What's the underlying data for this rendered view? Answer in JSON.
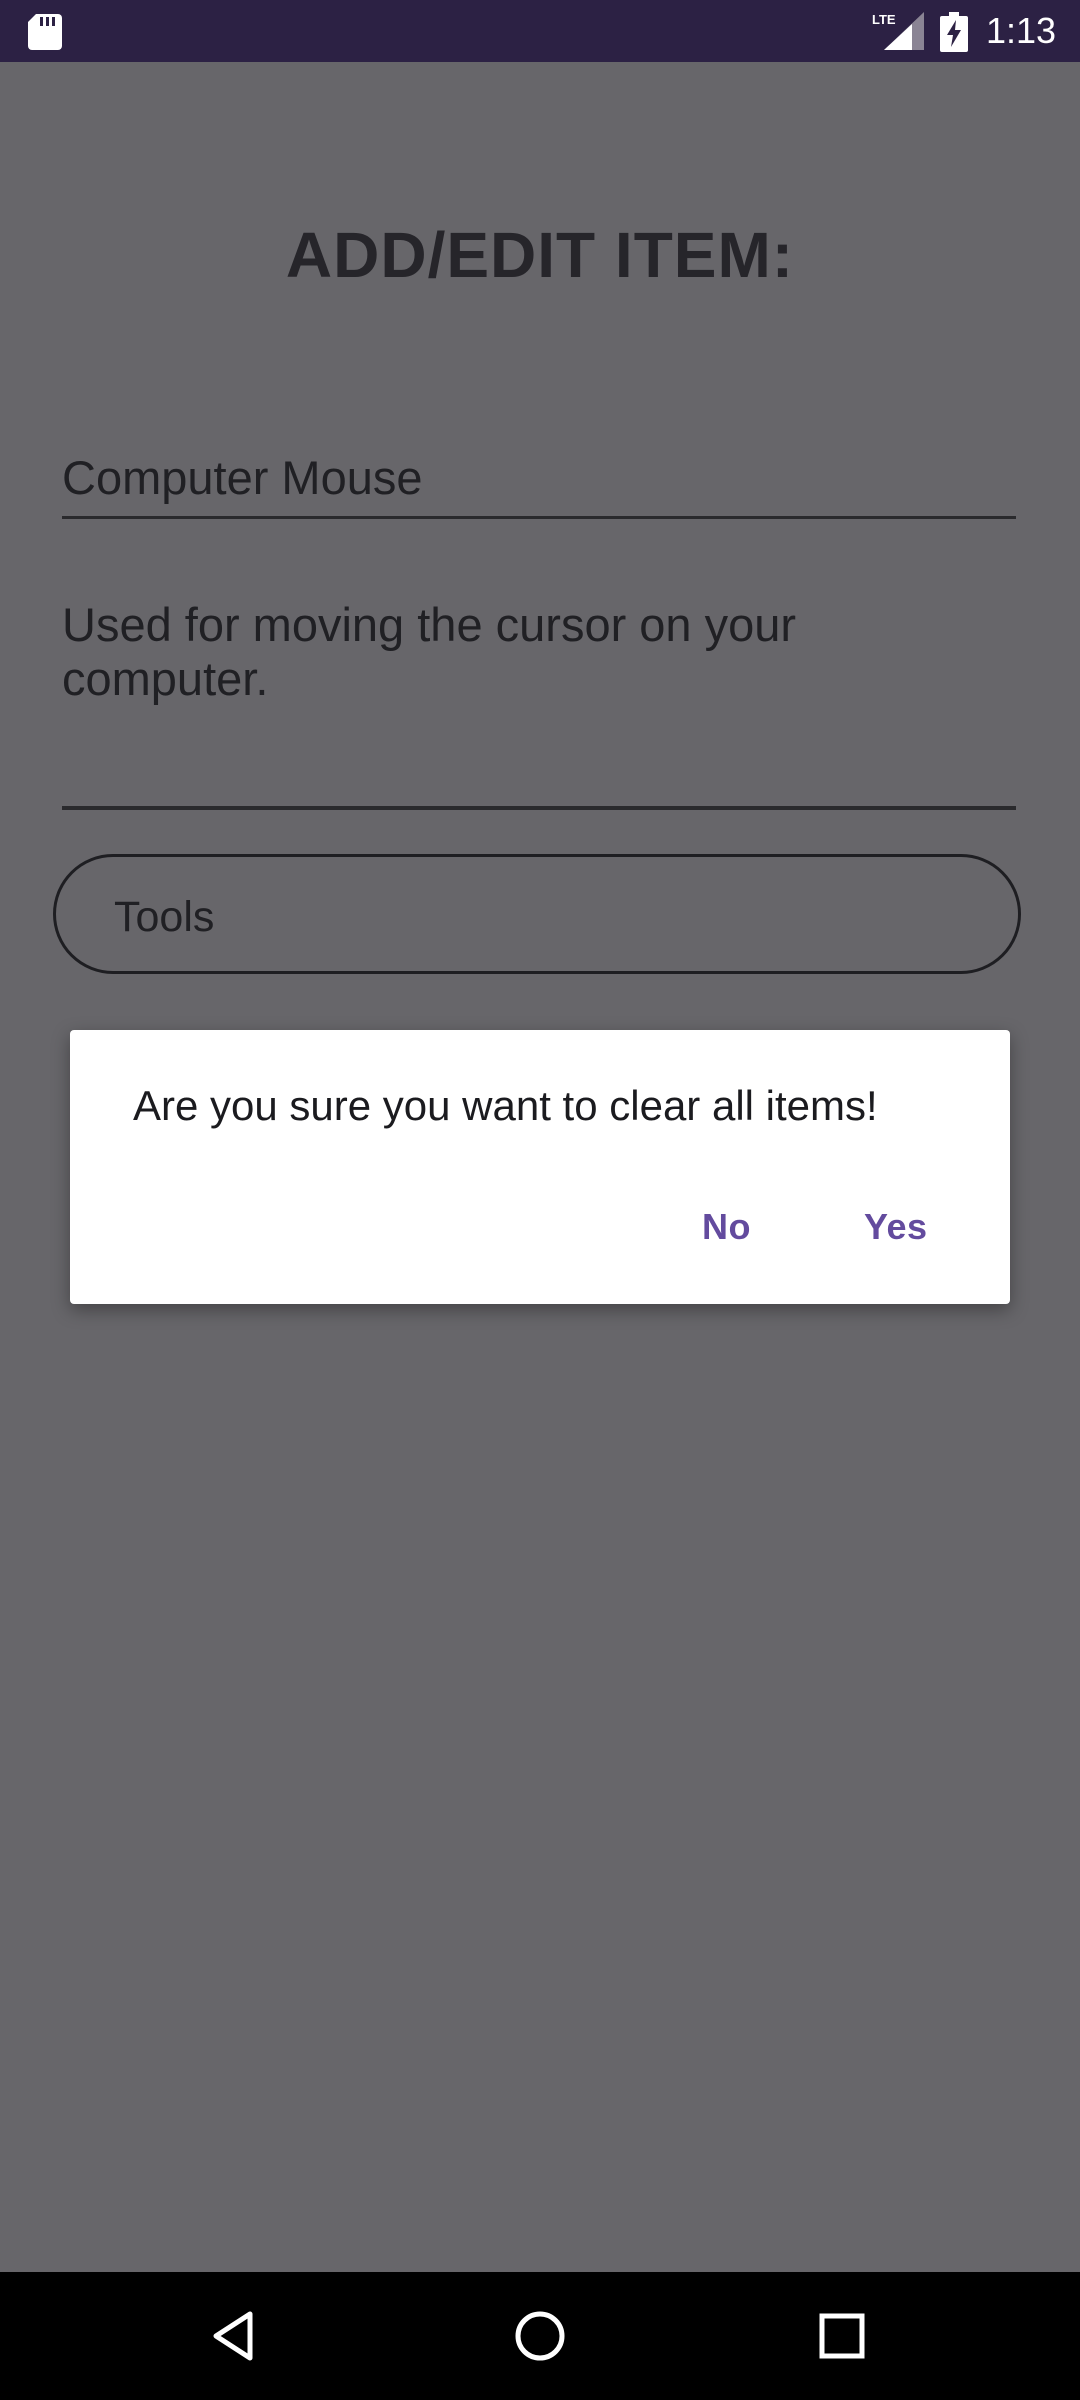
{
  "status_bar": {
    "time": "1:13",
    "network_label": "LTE",
    "icons": [
      "sd-card-icon",
      "lte-signal-icon",
      "battery-charging-icon"
    ]
  },
  "screen": {
    "title": "ADD/EDIT ITEM:",
    "name_field": {
      "value": "Computer Mouse"
    },
    "description_field": {
      "value": "Used for moving the cursor on your computer."
    },
    "category_select": {
      "value": "Tools"
    }
  },
  "dialog": {
    "message": "Are you sure you want to clear all items!",
    "no_label": "No",
    "yes_label": "Yes",
    "accent_color": "#634b9e"
  },
  "nav_bar": {
    "buttons": [
      "back-icon",
      "home-icon",
      "recents-icon"
    ]
  },
  "colors": {
    "status_bar_bg": "#2c2144",
    "scrim_bg": "#67666a",
    "nav_bar_bg": "#000000"
  }
}
